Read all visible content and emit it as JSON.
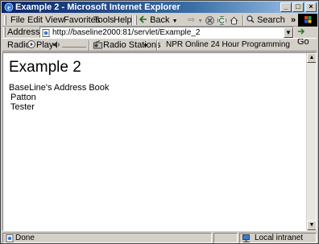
{
  "window": {
    "title": "Example 2 - Microsoft Internet Explorer",
    "controls": {
      "minimize": "_",
      "maximize": "□",
      "close": "×"
    }
  },
  "menubar": {
    "items": [
      {
        "label": "File"
      },
      {
        "label": "Edit"
      },
      {
        "label": "View"
      },
      {
        "label": "Favorites"
      },
      {
        "label": "Tools"
      },
      {
        "label": "Help"
      }
    ],
    "back_label": "Back",
    "search_label": "Search",
    "chevron": "»"
  },
  "address": {
    "label": "Address",
    "url": "http://baseline2000:81/servlet/Example_2",
    "go_label": "Go"
  },
  "radio": {
    "label": "Radio",
    "play_label": "Play",
    "stations_label": "Radio Stations",
    "now_playing": "NPR Online 24 Hour Programming"
  },
  "page": {
    "heading": "Example 2",
    "book_title": "BaseLine's Address Book",
    "entries": [
      "Patton",
      "Tester"
    ]
  },
  "status": {
    "text": "Done",
    "zone": "Local intranet"
  },
  "colors": {
    "titlebar_start": "#0a246a",
    "titlebar_end": "#a6caf0",
    "chrome": "#d4d0c8"
  }
}
